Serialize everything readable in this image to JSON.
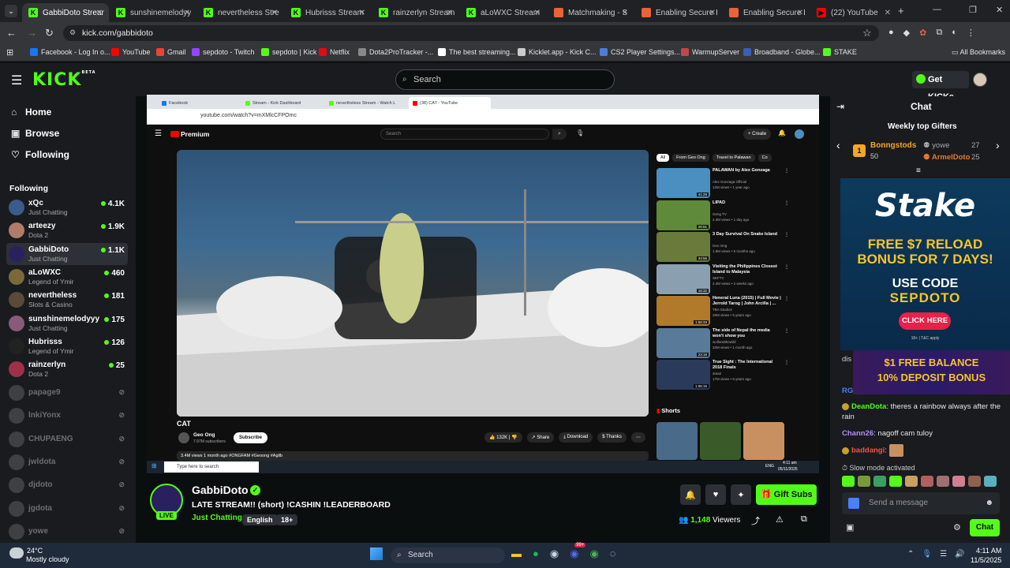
{
  "browser": {
    "tabs": [
      {
        "label": "GabbiDoto Stream",
        "fav": "K",
        "color": "#53fc18",
        "active": true
      },
      {
        "label": "sunshinemelodyy",
        "fav": "K",
        "color": "#53fc18"
      },
      {
        "label": "nevertheless Stre",
        "fav": "K",
        "color": "#53fc18"
      },
      {
        "label": "Hubrisss Stream",
        "fav": "K",
        "color": "#53fc18"
      },
      {
        "label": "rainzerlyn Stream",
        "fav": "K",
        "color": "#53fc18"
      },
      {
        "label": "aLoWXC Stream",
        "fav": "K",
        "color": "#53fc18"
      },
      {
        "label": "Matchmaking - S",
        "fav": "",
        "color": "#e8633a"
      },
      {
        "label": "Enabling Secure B",
        "fav": "",
        "color": "#e8633a"
      },
      {
        "label": "Enabling Secure B",
        "fav": "",
        "color": "#e8633a"
      },
      {
        "label": "(22) YouTube",
        "fav": "▶",
        "color": "#ff0000"
      }
    ],
    "url": "kick.com/gabbidoto",
    "bookmarks": [
      {
        "label": "Facebook - Log In o...",
        "color": "#1877f2"
      },
      {
        "label": "YouTube",
        "color": "#ff0000"
      },
      {
        "label": "Gmail",
        "color": "#ea4335"
      },
      {
        "label": "sepdoto - Twitch",
        "color": "#9146ff"
      },
      {
        "label": "sepdoto | Kick",
        "color": "#53fc18"
      },
      {
        "label": "Netflix",
        "color": "#e50914"
      },
      {
        "label": "Dota2ProTracker -...",
        "color": "#888888"
      },
      {
        "label": "The best streaming...",
        "color": "#ffffff"
      },
      {
        "label": "Kicklet.app - Kick C...",
        "color": "#cccccc"
      },
      {
        "label": "CS2 Player Settings...",
        "color": "#4a7fd1"
      },
      {
        "label": "WarmupServer",
        "color": "#c04848"
      },
      {
        "label": "Broadband - Globe...",
        "color": "#3a5fb5"
      },
      {
        "label": "STAKE",
        "color": "#53fc18"
      }
    ],
    "all_bookmarks": "All Bookmarks"
  },
  "header": {
    "logo": "KICK",
    "beta": "BETA",
    "search_placeholder": "Search",
    "get_kicks": "Get KICKs"
  },
  "sidebar": {
    "nav": [
      {
        "label": "Home",
        "icon": "⌂"
      },
      {
        "label": "Browse",
        "icon": "▣"
      },
      {
        "label": "Following",
        "icon": "♡"
      }
    ],
    "following_title": "Following",
    "following": [
      {
        "name": "xQc",
        "category": "Just Chatting",
        "viewers": "4.1K",
        "color": "#3b5b8a"
      },
      {
        "name": "arteezy",
        "category": "Dota 2",
        "viewers": "1.9K",
        "color": "#b07c6a"
      },
      {
        "name": "GabbiDoto",
        "category": "Just Chatting",
        "viewers": "1.1K",
        "color": "#2a2060"
      },
      {
        "name": "aLoWXC",
        "category": "Legend of Ymir",
        "viewers": "460",
        "color": "#7a6a3a"
      },
      {
        "name": "nevertheless",
        "category": "Slots & Casino",
        "viewers": "181",
        "color": "#5a4a3a"
      },
      {
        "name": "sunshinemelodyyy",
        "category": "Just Chatting",
        "viewers": "175",
        "color": "#8a5a7a"
      },
      {
        "name": "Hubrisss",
        "category": "Legend of Ymir",
        "viewers": "126",
        "color": "#222222"
      },
      {
        "name": "rainzerlyn",
        "category": "Dota 2",
        "viewers": "25",
        "color": "#a0304a"
      }
    ],
    "offline": [
      "papage9",
      "lnkiYonx",
      "CHUPAENG",
      "jwldota",
      "djdoto",
      "jgdota",
      "yowe"
    ]
  },
  "stream": {
    "tabs": [
      "Facebook",
      "Stream - Kick Dashboard",
      "nevertheless Stream - Watch L",
      "(38) CAT - YouTube"
    ],
    "url": "youtube.com/watch?v=mXMlcCFPOmc",
    "yt_logo": "Premium",
    "yt_search": "Search",
    "create": "Create",
    "video_title": "CAT",
    "channel": "Geo Ong",
    "subs": "7.97M subscribers",
    "subscribe": "Subscribe",
    "likes": "132K",
    "share": "Share",
    "download": "Download",
    "thanks": "Thanks",
    "desc": "3.4M views  1 month ago  #ONGFAM #Geoong #Agilb",
    "chips": [
      "All",
      "From Geo Ong",
      "Travel to Palawan",
      "Co"
    ],
    "recs": [
      {
        "title": "PALAWAN by Alex Gonzaga",
        "meta": "Alex Gonzaga Official",
        "meta2": "12M views • 1 year ago",
        "dur": "41:28",
        "color": "#4a8fbf"
      },
      {
        "title": "LIPAD",
        "meta": "Geng TV",
        "meta2": "4.3M views • 1 day ago",
        "dur": "26:51",
        "color": "#5f8a3a"
      },
      {
        "title": "3 Day Survival On Snake Island",
        "meta": "Geo Ong",
        "meta2": "1.9M views • 6 months ago",
        "dur": "34:56",
        "color": "#6a7a3a"
      },
      {
        "title": "Visiting the Philippines Closest Island to Malaysia",
        "meta": "SEFTV",
        "meta2": "2.4M views • 2 weeks ago",
        "dur": "18:32",
        "color": "#8aa0b0"
      },
      {
        "title": "Heneral Luna (2015) | Full Movie | Jerrold Tarog | John Arcilla | ...",
        "meta": "TBA Studios",
        "meta2": "26M views • 5 years ago",
        "dur": "1:58:33",
        "color": "#b07a2a"
      },
      {
        "title": "The side of Nepal the media won't show you",
        "meta": "wolfandthewild",
        "meta2": "32M views • 1 month ago",
        "dur": "23:18",
        "color": "#5a7a9a"
      },
      {
        "title": "True Sight : The International 2018 Finals",
        "meta": "dota2",
        "meta2": "17M views • 6 years ago",
        "dur": "1:06:15",
        "color": "#2a3a5a"
      }
    ],
    "shorts_title": "Shorts",
    "win_search": "Type here to search",
    "win_clock": "4:11 am",
    "win_date": "05/11/2025",
    "win_lang": "ENG"
  },
  "info": {
    "name": "GabbiDoto",
    "live": "LIVE",
    "title": "LATE STREAM!! (short)  !CASHIN !LEADERBOARD",
    "category": "Just Chatting",
    "tags": [
      "English",
      "18+"
    ],
    "gift_subs": "Gift Subs",
    "viewers": "1,148",
    "viewers_label": "Viewers"
  },
  "chat": {
    "title": "Chat",
    "gifters_title": "Weekly top Gifters",
    "gifters": [
      {
        "rank": "1",
        "name": "Bonngstods",
        "count": "50",
        "color": "#f5a623"
      },
      {
        "name": "yowe",
        "count": "27",
        "color": "#a8a8a8"
      },
      {
        "name": "ArmelDoto",
        "count": "25",
        "color": "#e87b2a"
      }
    ],
    "ad": {
      "brand": "Stake",
      "line1": "FREE $7 RELOAD",
      "line2": "BONUS FOR 7 DAYS!",
      "code_label": "USE CODE",
      "code": "SEPDOTO",
      "cta": "CLICK HERE",
      "fine": "18+ | T&C apply",
      "b1": "$1 FREE BALANCE",
      "b2": "10% DEPOSIT BONUS"
    },
    "partial1": "dis",
    "partial2": "RG",
    "messages": [
      {
        "user": "DeanDota",
        "text": "theres a rainbow always after the rain",
        "color": "#53fc18"
      },
      {
        "user": "Chann26",
        "text": "nagoff cam tuloy",
        "color": "#b48cff"
      },
      {
        "user": "baddangi",
        "text": "",
        "color": "#ff4d4d"
      }
    ],
    "slow_mode": "Slow mode activated",
    "send_placeholder": "Send a message",
    "chat_button": "Chat"
  },
  "taskbar": {
    "weather_temp": "24°C",
    "weather_desc": "Mostly cloudy",
    "search": "Search",
    "time": "4:11 AM",
    "date": "11/5/2025",
    "badge": "99+"
  }
}
